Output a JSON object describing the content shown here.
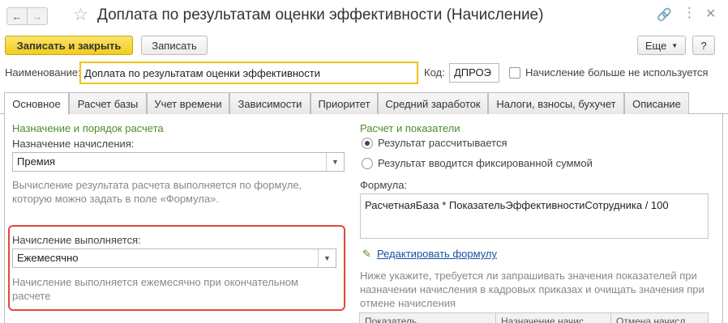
{
  "window": {
    "title": "Доплата по результатам оценки эффективности (Начисление)"
  },
  "toolbar": {
    "save_close": "Записать и закрыть",
    "save": "Записать",
    "more": "Еще",
    "help": "?"
  },
  "name_row": {
    "name_label": "Наименование:",
    "name_value": "Доплата по результатам оценки эффективности",
    "code_label": "Код:",
    "code_value": "ДПРОЭ",
    "unused_label": "Начисление больше не используется"
  },
  "tabs": [
    {
      "label": "Основное",
      "active": true
    },
    {
      "label": "Расчет базы"
    },
    {
      "label": "Учет времени"
    },
    {
      "label": "Зависимости"
    },
    {
      "label": "Приоритет"
    },
    {
      "label": "Средний заработок"
    },
    {
      "label": "Налоги, взносы, бухучет"
    },
    {
      "label": "Описание"
    }
  ],
  "left": {
    "heading": "Назначение и порядок расчета",
    "purpose_label": "Назначение начисления:",
    "purpose_value": "Премия",
    "purpose_hint": "Вычисление результата расчета выполняется по формуле, которую можно задать в поле «Формула».",
    "frequency_label": "Начисление выполняется:",
    "frequency_value": "Ежемесячно",
    "frequency_hint": "Начисление выполняется ежемесячно при окончательном расчете"
  },
  "right": {
    "heading": "Расчет и показатели",
    "radio_calculated": "Результат рассчитывается",
    "radio_fixed": "Результат вводится фиксированной суммой",
    "formula_label": "Формула:",
    "formula_value": "РасчетнаяБаза * ПоказательЭффективностиСотрудника / 100",
    "edit_formula_link": "Редактировать формулу",
    "indicators_hint": "Ниже укажите, требуется ли запрашивать значения показателей при назначении начисления в кадровых приказах и очищать значения при отмене начисления",
    "table_headers": [
      "Показатель",
      "Назначение начис",
      "Отмена начисл"
    ]
  },
  "colors": {
    "accent_yellow": "#f2cc1c",
    "section_green": "#4c8a2f",
    "highlight_red": "#e5463c",
    "link_blue": "#1a4fa0"
  }
}
